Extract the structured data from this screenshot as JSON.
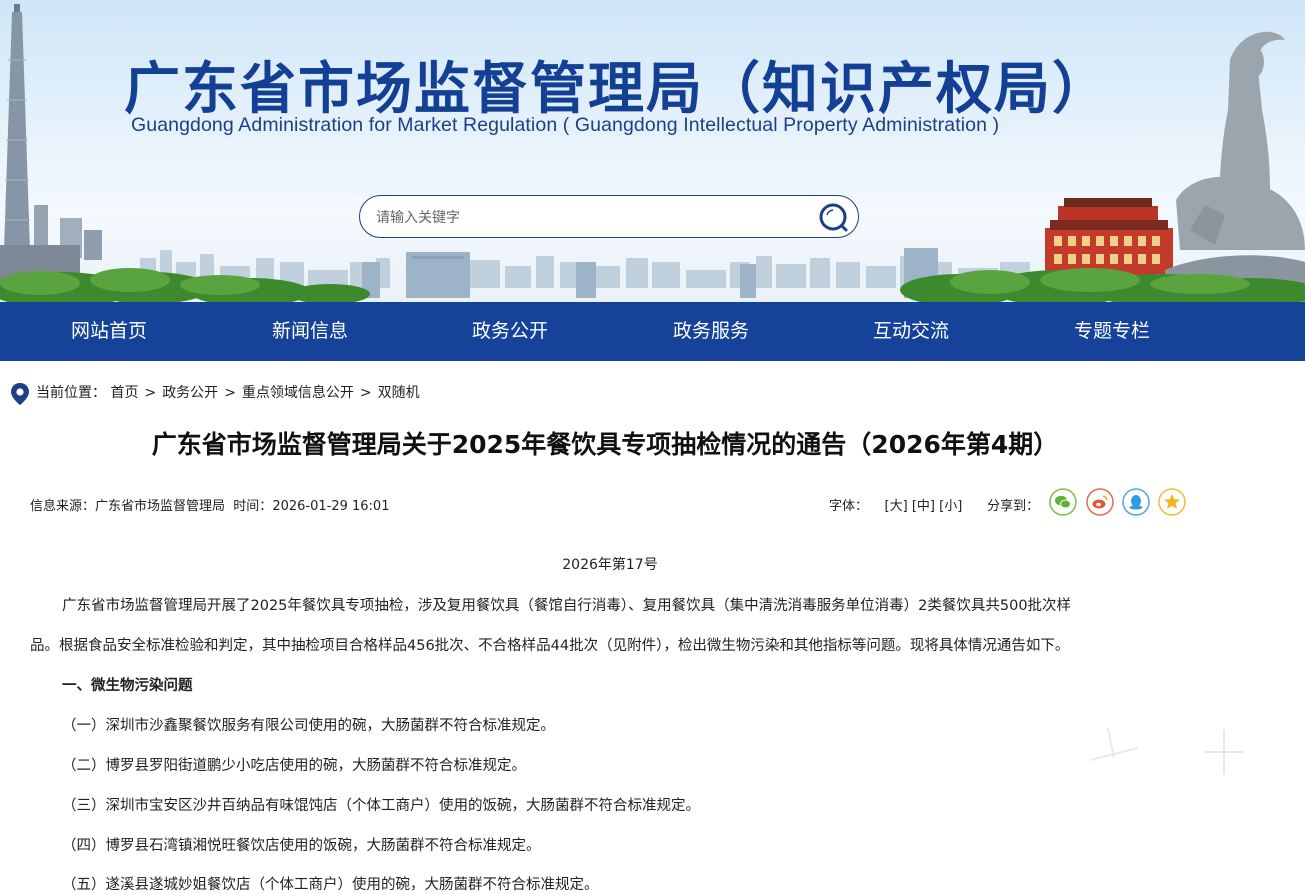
{
  "banner": {
    "title_cn": "广东省市场监督管理局（知识产权局）",
    "title_en": "Guangdong Administration for Market Regulation ( Guangdong Intellectual Property Administration )",
    "search_placeholder": "请输入关键字",
    "search_icon": "search-icon"
  },
  "nav": {
    "items": [
      "网站首页",
      "新闻信息",
      "政务公开",
      "政务服务",
      "互动交流",
      "专题专栏"
    ],
    "bg_color": "#15439a"
  },
  "breadcrumb": {
    "label": "当前位置：",
    "items": [
      "首页",
      "政务公开",
      "重点领域信息公开",
      "双随机"
    ],
    "separator": ">"
  },
  "article": {
    "title": "广东省市场监督管理局关于2025年餐饮具专项抽检情况的通告（2026年第4期）",
    "source_label": "信息来源：",
    "source": "广东省市场监督管理局",
    "time_label": "时间：",
    "time": "2026-01-29 16:01",
    "font_label": "字体：",
    "font_sizes": [
      "[大]",
      "[中]",
      "[小]"
    ],
    "share_label": "分享到：",
    "share_icons": [
      "wechat-icon",
      "weibo-icon",
      "qq-icon",
      "qzone-icon"
    ],
    "issue_no": "2026年第17号",
    "paragraphs": [
      "广东省市场监督管理局开展了2025年餐饮具专项抽检，涉及复用餐饮具（餐馆自行消毒）、复用餐饮具（集中清洗消毒服务单位消毒）2类餐饮具共500批次样",
      "品。根据食品安全标准检验和判定，其中抽检项目合格样品456批次、不合格样品44批次（见附件），检出微生物污染和其他指标等问题。现将具体情况通告如下。"
    ],
    "section_heading": "一、微生物污染问题",
    "items": [
      "（一）深圳市沙鑫聚餐饮服务有限公司使用的碗，大肠菌群不符合标准规定。",
      "（二）博罗县罗阳街道鹏少小吃店使用的碗，大肠菌群不符合标准规定。",
      "（三）深圳市宝安区沙井百纳品有味馄饨店（个体工商户）使用的饭碗，大肠菌群不符合标准规定。",
      "（四）博罗县石湾镇湘悦旺餐饮店使用的饭碗，大肠菌群不符合标准规定。",
      "（五）遂溪县遂城妙姐餐饮店（个体工商户）使用的碗，大肠菌群不符合标准规定。"
    ]
  },
  "watermark": {
    "text": "南方+",
    "icon": "nanfang-plus-watermark"
  }
}
